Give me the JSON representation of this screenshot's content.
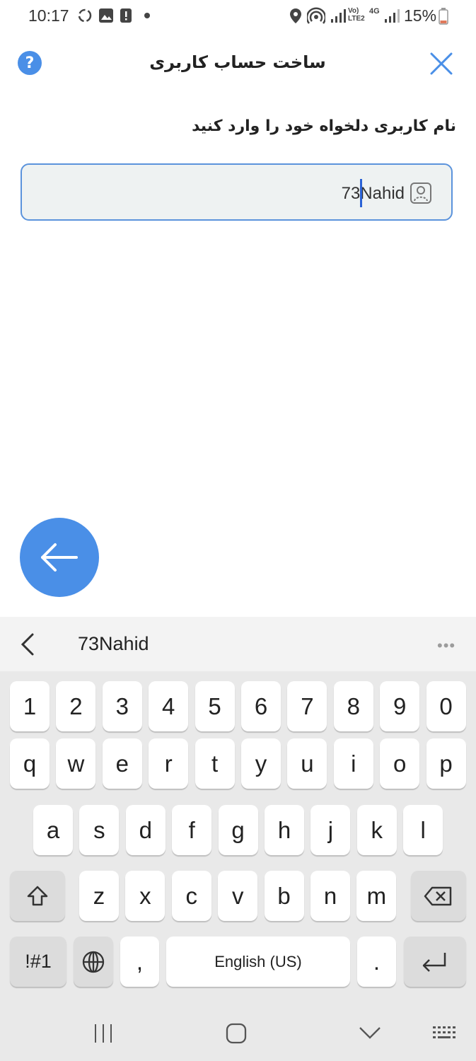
{
  "status_bar": {
    "time": "10:17",
    "battery": "15%",
    "icons": [
      "sync-icon",
      "image-icon",
      "alert-icon",
      "dot-icon",
      "location-icon",
      "hotspot-icon",
      "signal-icon",
      "volte-icon",
      "4g-icon",
      "signal-icon",
      "battery-icon"
    ],
    "network_text": "Vo) LTE2",
    "network_type": "4G"
  },
  "header": {
    "title": "ساخت حساب کاربری",
    "help_label": "?",
    "close_icon": "close-icon"
  },
  "form": {
    "prompt": "نام کاربری دلخواه خود را وارد کنید",
    "username_value": "73Nahid",
    "field_icon": "user-badge-icon"
  },
  "actions": {
    "next_icon": "arrow-left-icon"
  },
  "keyboard": {
    "suggestion": "73Nahid",
    "more_label": "•••",
    "rows": {
      "numbers": [
        "1",
        "2",
        "3",
        "4",
        "5",
        "6",
        "7",
        "8",
        "9",
        "0"
      ],
      "row1": [
        "q",
        "w",
        "e",
        "r",
        "t",
        "y",
        "u",
        "i",
        "o",
        "p"
      ],
      "row2": [
        "a",
        "s",
        "d",
        "f",
        "g",
        "h",
        "j",
        "k",
        "l"
      ],
      "row3": [
        "z",
        "x",
        "c",
        "v",
        "b",
        "n",
        "m"
      ]
    },
    "symbols_label": "!#1",
    "comma_label": ",",
    "space_label": "English (US)",
    "period_label": "."
  },
  "colors": {
    "accent": "#4a8fe7",
    "field_border": "#5b93dc",
    "field_bg": "#eef2f2",
    "keyboard_bg": "#e9e9e9"
  }
}
